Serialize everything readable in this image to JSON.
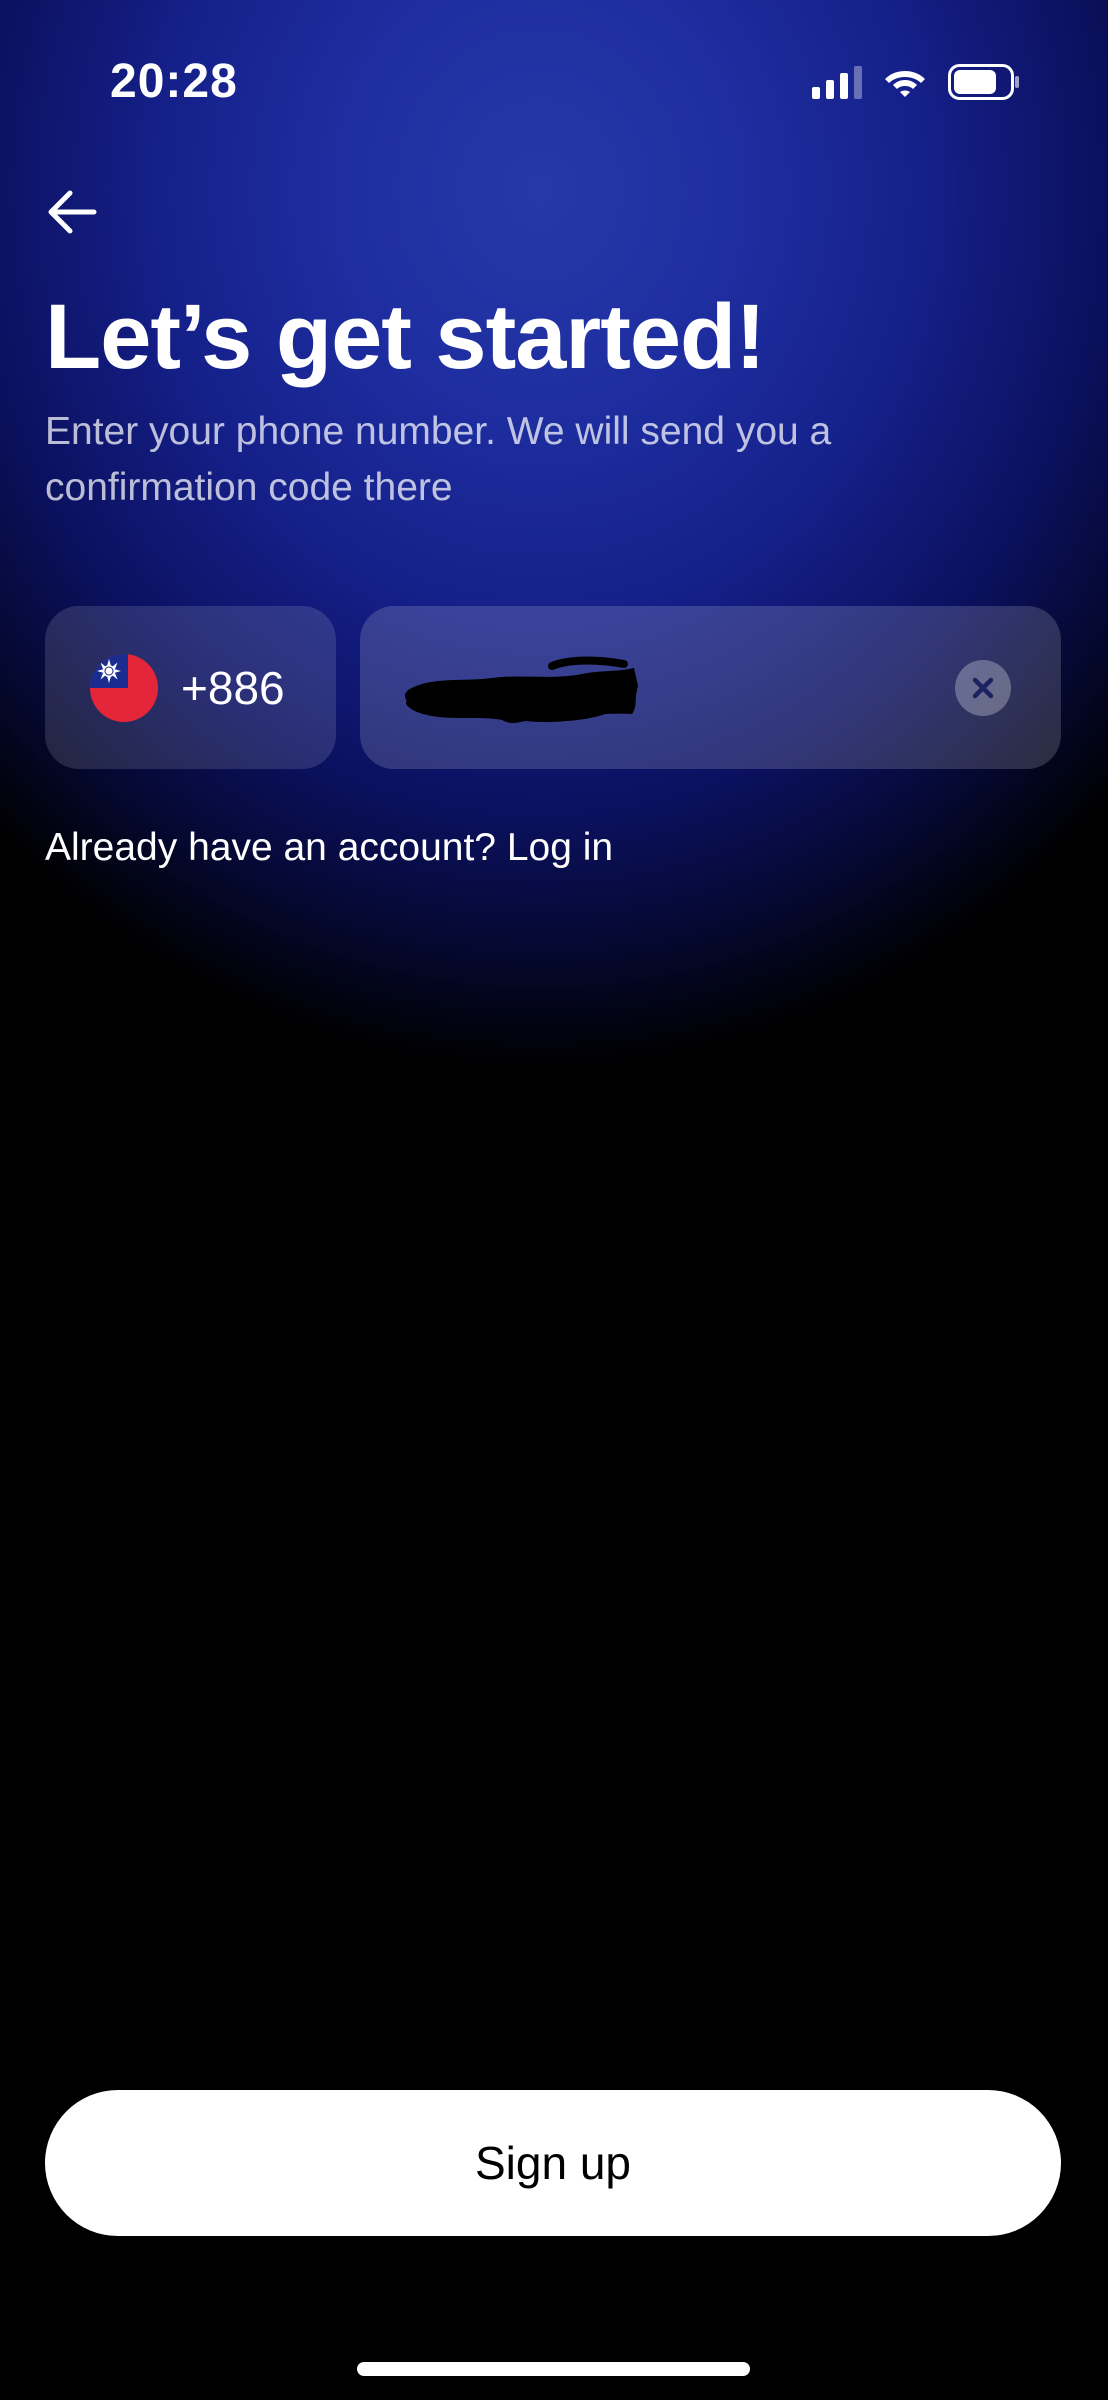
{
  "status_bar": {
    "time": "20:28",
    "icons": [
      "cellular-signal-icon",
      "wifi-icon",
      "battery-icon"
    ]
  },
  "header": {
    "back_icon": "arrow-left-icon",
    "title": "Let’s get started!",
    "subtitle": "Enter your phone number. We will send you a confirmation code there"
  },
  "phone_form": {
    "country_flag_icon": "taiwan-flag-icon",
    "country_code": "+886",
    "phone_value": "",
    "clear_icon": "clear-x-icon"
  },
  "login": {
    "prompt": "Already have an account?",
    "link_label": "Log in"
  },
  "actions": {
    "signup_label": "Sign up"
  },
  "colors": {
    "background_top": "#1e2ea0",
    "background_bottom": "#000000",
    "button_background": "#ffffff",
    "button_text": "#000000",
    "flag_red": "#e5263a",
    "flag_blue": "#1a2c8f"
  }
}
